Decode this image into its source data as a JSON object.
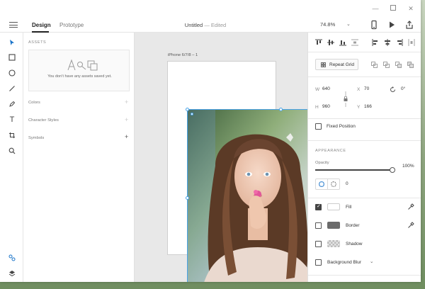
{
  "header": {
    "tabs": [
      {
        "label": "Design",
        "active": true
      },
      {
        "label": "Prototype",
        "active": false
      }
    ],
    "doc_title": "Untitled",
    "doc_separator": "—",
    "doc_status": "Edited",
    "zoom": "74.8%"
  },
  "assets": {
    "heading": "ASSETS",
    "empty_message": "You don’t have any assets saved yet.",
    "sections": [
      "Colors",
      "Character Styles",
      "Symbols"
    ]
  },
  "canvas": {
    "artboard_name": "iPhone 6/7/8 – 1"
  },
  "inspector": {
    "repeat_grid_label": "Repeat Grid",
    "w_label": "W",
    "w_value": "640",
    "h_label": "H",
    "h_value": "960",
    "x_label": "X",
    "x_value": "70",
    "y_label": "Y",
    "y_value": "166",
    "rotation_value": "0°",
    "fixed_position_label": "Fixed Position",
    "appearance_heading": "APPEARANCE",
    "opacity_label": "Opacity",
    "opacity_value": "100%",
    "opacity_fraction": 1.0,
    "corner_radius_value": "0",
    "fill_label": "Fill",
    "border_label": "Border",
    "shadow_label": "Shadow",
    "background_blur_label": "Background Blur",
    "fill_checked": true,
    "border_checked": false,
    "shadow_checked": false,
    "blur_checked": false,
    "fixed_position_checked": false
  },
  "colors": {
    "accent": "#4aa3e8",
    "fill_swatch": "#ffffff",
    "border_swatch": "#6b6b6b",
    "canvas_bg": "#e8e8e8"
  },
  "icons": {
    "window_controls": [
      "minimize-icon",
      "maximize-icon",
      "close-icon"
    ],
    "header_right": [
      "phone-preview-icon",
      "play-icon",
      "share-icon"
    ],
    "tools": [
      "select-icon",
      "rectangle-icon",
      "ellipse-icon",
      "line-icon",
      "pen-icon",
      "text-icon",
      "artboard-icon",
      "zoom-icon",
      "assets-icon",
      "layers-icon"
    ]
  }
}
